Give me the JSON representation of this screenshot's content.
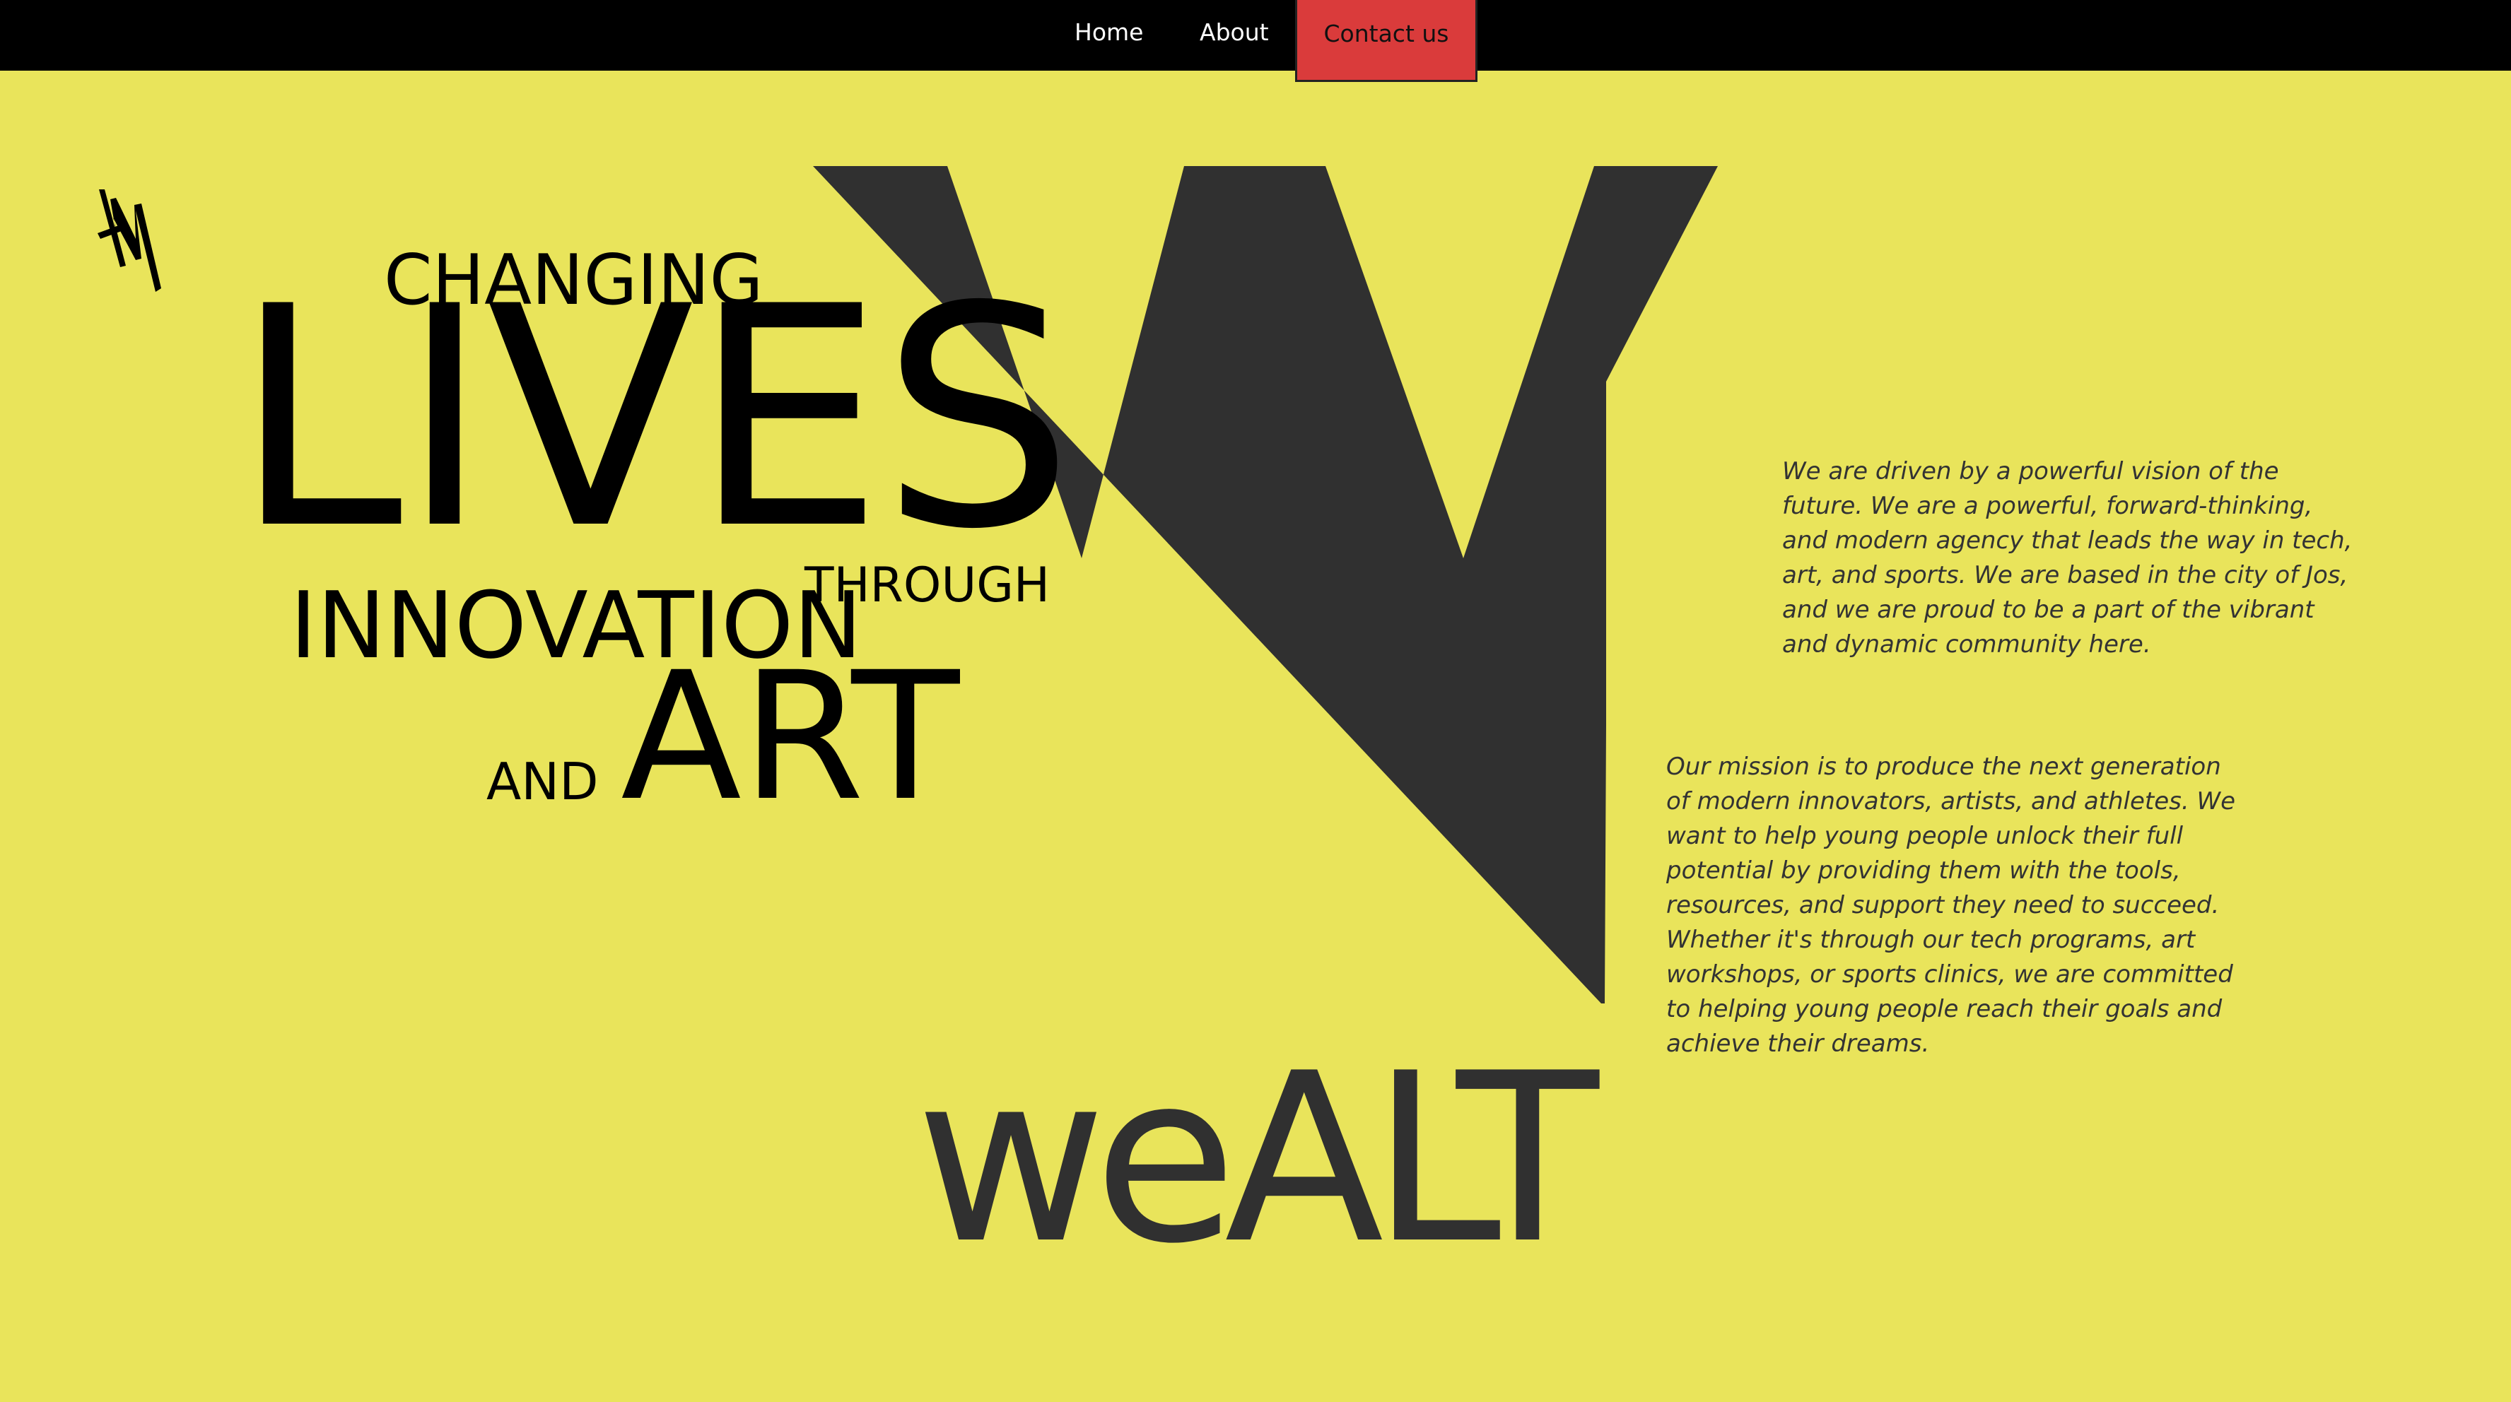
{
  "nav": {
    "home_label": "Home",
    "about_label": "About",
    "contact_label": "Contact us",
    "contact_color": "#da3b3b"
  },
  "hero": {
    "word_changing": "CHANGING",
    "word_lives": "LIVES",
    "word_innovation": "INNOVATION",
    "word_through": "THROUGH",
    "word_and": "AND",
    "word_art": "ART"
  },
  "brand": {
    "wordmark": "weALT",
    "logo_icon": "w-logo-icon",
    "big_logo_icon": "big-w-logo-icon",
    "background_color": "#e9e45b",
    "logo_color": "#303030"
  },
  "content": {
    "vision_text": "We are driven by a powerful vision of the future. We are a powerful, forward-thinking, and modern agency that leads the way in tech, art, and sports. We are based in the city of Jos, and we are proud to be a part of the vibrant and dynamic community here.",
    "mission_text": "Our mission is to produce the next generation of modern innovators, artists, and athletes. We want to help young people unlock their full potential by providing them with the tools, resources, and support they need to succeed. Whether it's through our tech programs, art workshops, or sports clinics, we are committed to helping young people reach their goals and achieve their dreams."
  }
}
